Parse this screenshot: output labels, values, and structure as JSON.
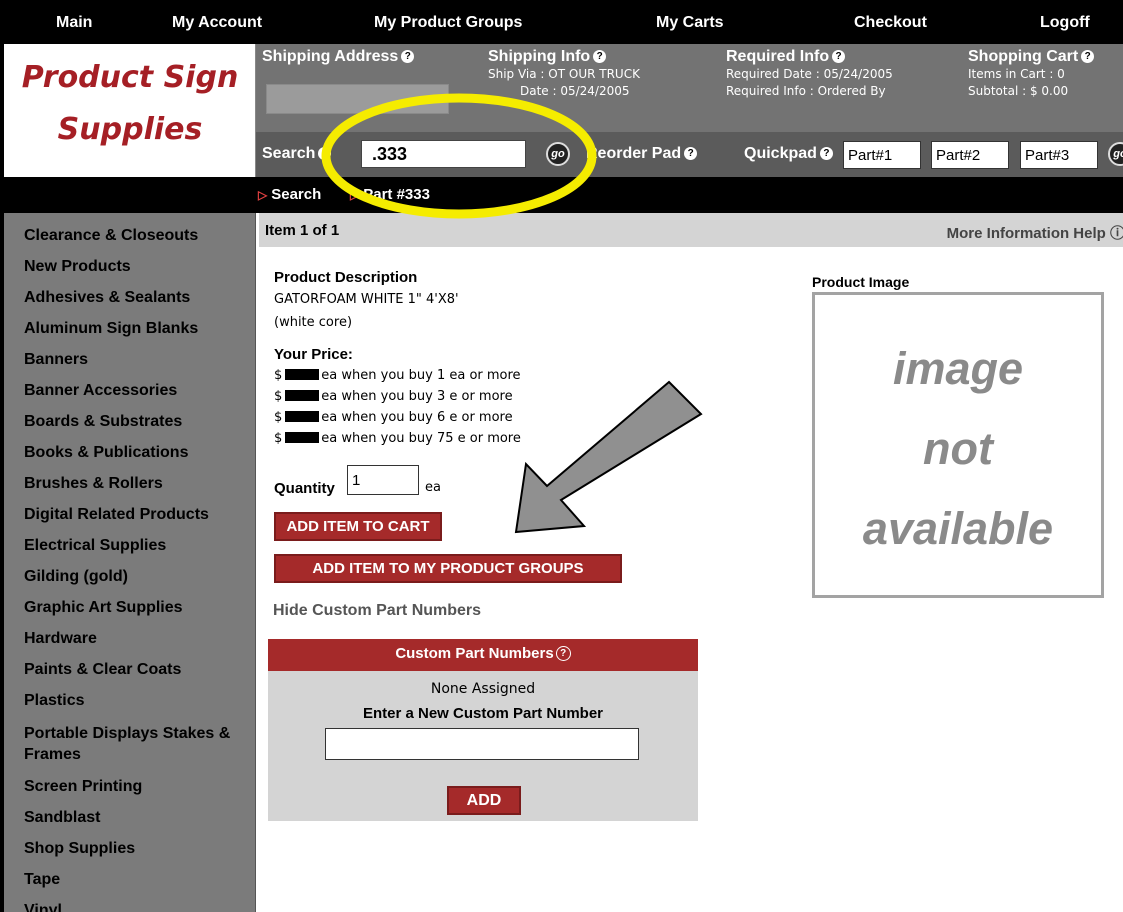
{
  "nav": {
    "items": [
      "Main",
      "My Account",
      "My Product Groups",
      "My Carts",
      "Checkout",
      "Logoff"
    ]
  },
  "logo": {
    "line1": "Product Sign",
    "line2": "Supplies"
  },
  "info": {
    "shipping_address": {
      "title": "Shipping Address"
    },
    "shipping_info": {
      "title": "Shipping Info",
      "line1": "Ship Via : OT OUR TRUCK",
      "line2": "Date : 05/24/2005"
    },
    "required_info": {
      "title": "Required Info",
      "line1": "Required Date : 05/24/2005",
      "line2": "Required Info : Ordered By"
    },
    "shopping_cart": {
      "title": "Shopping Cart",
      "line1": "Items in Cart : 0",
      "line2": "Subtotal : $ 0.00"
    }
  },
  "search": {
    "label": "Search",
    "value": ".333",
    "go": "go",
    "reorder_label": "Reorder Pad",
    "quickpad_label": "Quickpad",
    "quickpad_values": [
      "Part#1",
      "Part#2",
      "Part#3"
    ]
  },
  "breadcrumb": {
    "items": [
      "Search",
      "Part #333"
    ]
  },
  "sidebar": {
    "items": [
      "Clearance & Closeouts",
      "New Products",
      "Adhesives & Sealants",
      "Aluminum Sign Blanks",
      "Banners",
      "Banner Accessories",
      "Boards & Substrates",
      "Books & Publications",
      "Brushes & Rollers",
      "Digital Related Products",
      "Electrical Supplies",
      "Gilding (gold)",
      "Graphic Art Supplies",
      "Hardware",
      "Paints & Clear Coats",
      "Plastics",
      "Portable Displays Stakes & Frames",
      "Screen Printing",
      "Sandblast",
      "Shop Supplies",
      "Tape",
      "Vinyl"
    ]
  },
  "item": {
    "counter": "Item 1 of 1",
    "help_link": "More Information Help",
    "description_label": "Product Description",
    "description_line1": "GATORFOAM WHITE 1\" 4'X8'",
    "description_line2": "(white core)",
    "price_label": "Your Price:",
    "price_rows": [
      "ea when you buy 1 ea or more",
      "ea when you buy 3 e or more",
      "ea when you buy 6 e or more",
      "ea when you buy 75 e or more"
    ],
    "currency": "$",
    "quantity_label": "Quantity",
    "quantity_value": "1",
    "quantity_unit": "ea",
    "add_to_cart": "ADD ITEM TO CART",
    "add_to_groups": "ADD ITEM TO MY PRODUCT GROUPS",
    "hide_custom": "Hide Custom Part Numbers",
    "image_label": "Product Image",
    "image_placeholder": [
      "image",
      "not",
      "available"
    ]
  },
  "custom_parts": {
    "title": "Custom Part Numbers",
    "none_assigned": "None Assigned",
    "enter_new": "Enter a New Custom Part Number",
    "add_button": "ADD"
  },
  "colors": {
    "brand_red": "#a52a2a",
    "annotation_yellow": "#f5ec00",
    "annotation_arrow": "#909090"
  }
}
